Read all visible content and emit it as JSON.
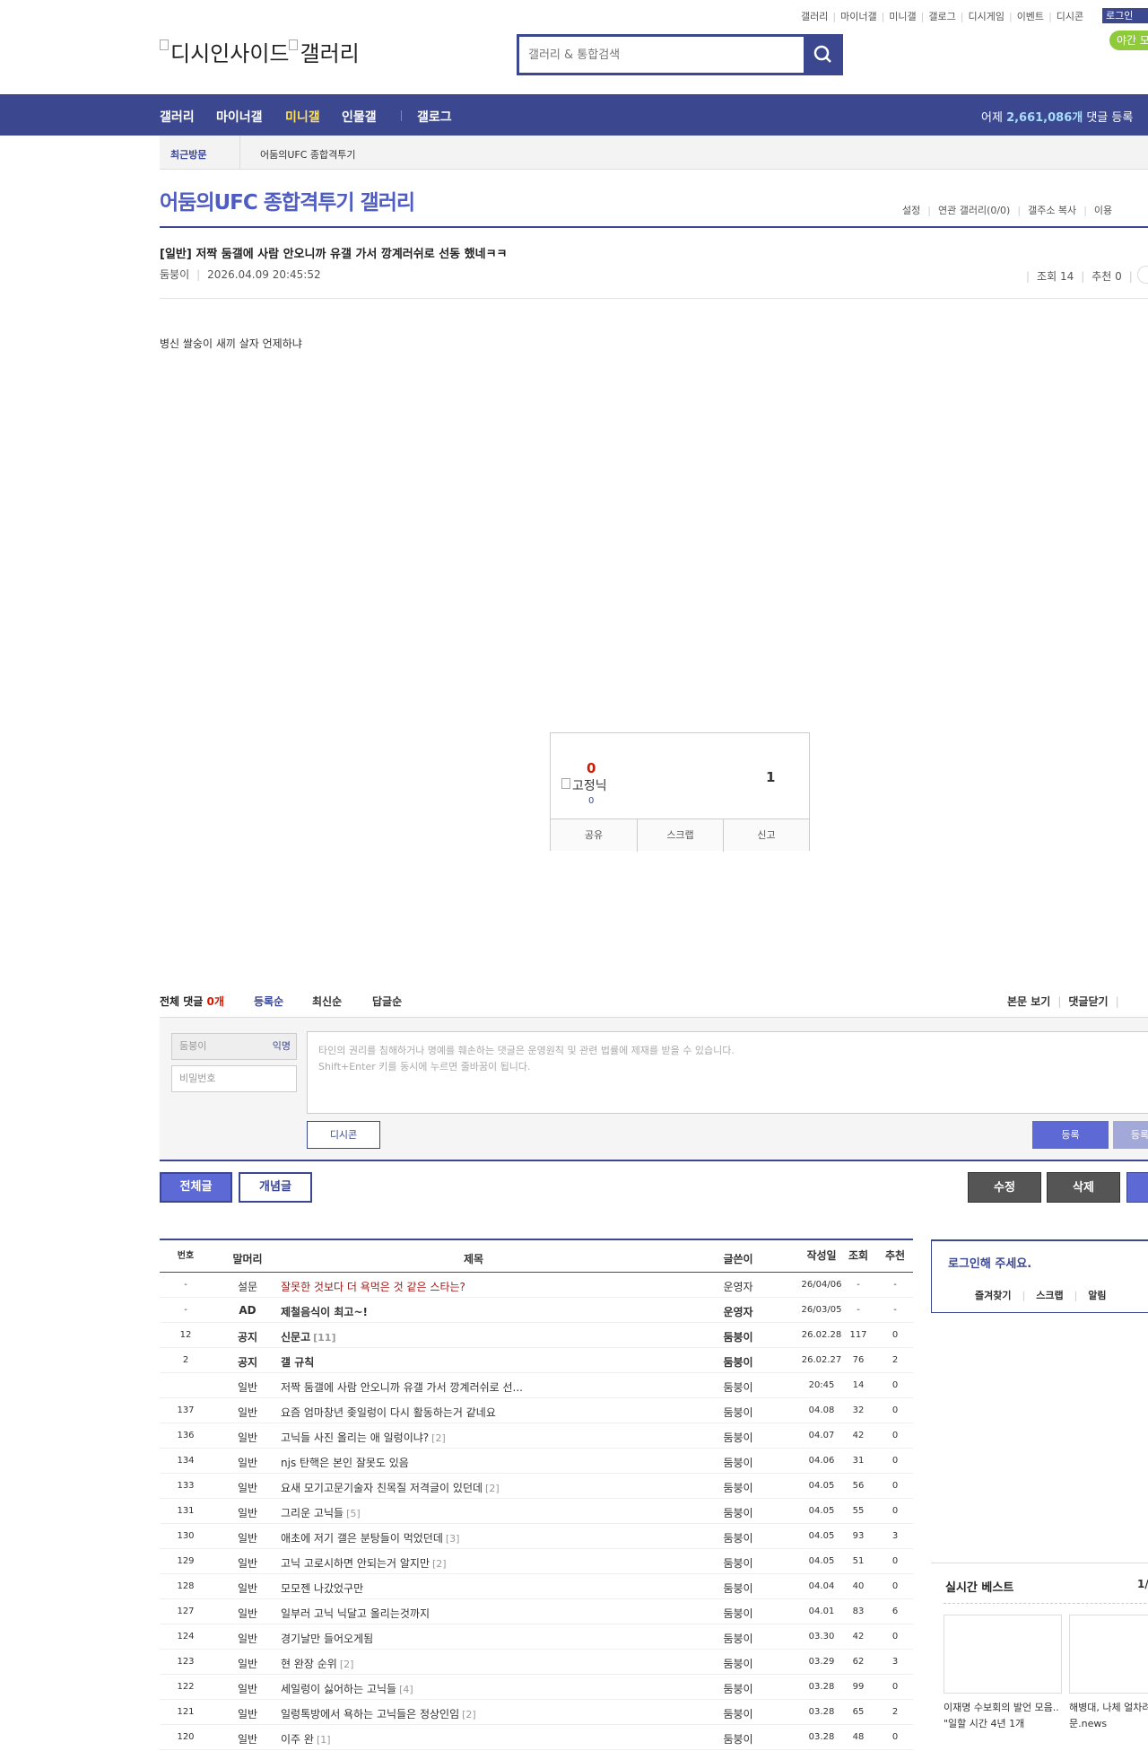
{
  "top_links": [
    "갤러리",
    "마이너갤",
    "미니갤",
    "갤로그",
    "디시게임",
    "이벤트",
    "디시콘"
  ],
  "login_label": "로그인",
  "night_label": "야간 모드",
  "logo_text": "디시인사이드",
  "logo_text2": "갤러리",
  "search": {
    "placeholder": "갤러리 & 통합검색"
  },
  "nav": {
    "items": [
      "갤러리",
      "마이너갤",
      "미니갤",
      "인물갤",
      "갤로그"
    ],
    "active": "미니갤",
    "right_prefix": "어제 ",
    "right_count": "2,661,086개",
    "right_suffix": " 댓글 등록"
  },
  "recent": {
    "label": "최근방문",
    "item": "어둠의UFC 종합격투기"
  },
  "gallery": {
    "title": "어둠의UFC 종합격투기 갤러리",
    "links": [
      "설정",
      "연관 갤러리(0/0)",
      "갤주소 복사",
      "이용"
    ]
  },
  "post": {
    "title": "[일반] 저짝 둠갤에 사람 안오니까 유갤 가서 깡계러쉬로 선동 했네ㅋㅋ",
    "author": "둠붕이",
    "date": "2026.04.09 20:45:52",
    "views": "조회 14",
    "recommend": "추천 0",
    "body": "병신 쌀숭이 새끼 살자 언제하냐"
  },
  "rec_box": {
    "up": "0",
    "fixed_label": "고정닉",
    "fixed_count": "0",
    "down": "1",
    "actions": [
      "공유",
      "스크랩",
      "신고"
    ]
  },
  "comments": {
    "head_label": "전체 댓글 ",
    "count": "0개",
    "sort": [
      "등록순",
      "최신순",
      "답글순"
    ],
    "right_links": [
      "본문 보기",
      "댓글닫기"
    ],
    "name_placeholder": "둠붕이",
    "anon_label": "익명",
    "pw_placeholder": "비밀번호",
    "text_line1": "타인의 권리를 침해하거나 명예를 훼손하는 댓글은 운영원칙 및 관련 법률에 제재를 받을 수 있습니다.",
    "text_line2": "Shift+Enter 키를 동시에 누르면 줄바꿈이 됩니다.",
    "dccon_label": "디시콘",
    "submit_label": "등록",
    "submit2_label": "등록"
  },
  "buttons": {
    "all": "전체글",
    "concept": "개념글",
    "edit": "수정",
    "delete": "삭제"
  },
  "list": {
    "headers": {
      "num": "번호",
      "head": "말머리",
      "title": "제목",
      "writer": "글쓴이",
      "date": "작성일",
      "view": "조회",
      "rec": "추천"
    },
    "rows": [
      {
        "num": "-",
        "head": "설문",
        "title": "잘못한 것보다 더 욕먹은 것 같은 스타는?",
        "reply": "",
        "writer": "운영자",
        "date": "26/04/06",
        "view": "-",
        "rec": "-",
        "type": "survey"
      },
      {
        "num": "-",
        "head": "AD",
        "title": "제철음식이 최고~!",
        "reply": "",
        "writer": "운영자",
        "date": "26/03/05",
        "view": "-",
        "rec": "-",
        "type": "notice"
      },
      {
        "num": "12",
        "head": "공지",
        "title": "신문고",
        "reply": "[11]",
        "writer": "둠붕이",
        "date": "26.02.28",
        "view": "117",
        "rec": "0",
        "type": "notice"
      },
      {
        "num": "2",
        "head": "공지",
        "title": "갤 규칙",
        "reply": "",
        "writer": "둠붕이",
        "date": "26.02.27",
        "view": "76",
        "rec": "2",
        "type": "notice"
      },
      {
        "num": "",
        "head": "일반",
        "title": "저짝 둠갤에 사람 안오니까 유갤 가서 깡계러쉬로 선...",
        "reply": "",
        "writer": "둠붕이",
        "date": "20:45",
        "view": "14",
        "rec": "0",
        "type": "normal"
      },
      {
        "num": "137",
        "head": "일반",
        "title": "요즘 엄마창년 좆일렁이 다시 활동하는거 같네요",
        "reply": "",
        "writer": "둠붕이",
        "date": "04.08",
        "view": "32",
        "rec": "0",
        "type": "normal"
      },
      {
        "num": "136",
        "head": "일반",
        "title": "고닉들 사진 올리는 애 일렁이냐?",
        "reply": "[2]",
        "writer": "둠붕이",
        "date": "04.07",
        "view": "42",
        "rec": "0",
        "type": "normal"
      },
      {
        "num": "134",
        "head": "일반",
        "title": "njs 탄핵은 본인 잘못도 있음",
        "reply": "",
        "writer": "둠붕이",
        "date": "04.06",
        "view": "31",
        "rec": "0",
        "type": "normal"
      },
      {
        "num": "133",
        "head": "일반",
        "title": "요새 모기고문기술자 친목질 저격글이 있던데",
        "reply": "[2]",
        "writer": "둠붕이",
        "date": "04.05",
        "view": "56",
        "rec": "0",
        "type": "normal"
      },
      {
        "num": "131",
        "head": "일반",
        "title": "그리운 고닉들",
        "reply": "[5]",
        "writer": "둠붕이",
        "date": "04.05",
        "view": "55",
        "rec": "0",
        "type": "normal"
      },
      {
        "num": "130",
        "head": "일반",
        "title": "애초에 저기 갤은 분탕들이 먹었던데",
        "reply": "[3]",
        "writer": "둠붕이",
        "date": "04.05",
        "view": "93",
        "rec": "3",
        "type": "normal"
      },
      {
        "num": "129",
        "head": "일반",
        "title": "고닉 고로시하면 안되는거 알지만",
        "reply": "[2]",
        "writer": "둠붕이",
        "date": "04.05",
        "view": "51",
        "rec": "0",
        "type": "normal"
      },
      {
        "num": "128",
        "head": "일반",
        "title": "모모젠 나갔었구만",
        "reply": "",
        "writer": "둠붕이",
        "date": "04.04",
        "view": "40",
        "rec": "0",
        "type": "normal"
      },
      {
        "num": "127",
        "head": "일반",
        "title": "일부러 고닉 닉달고 올리는것까지",
        "reply": "",
        "writer": "둠붕이",
        "date": "04.01",
        "view": "83",
        "rec": "6",
        "type": "normal"
      },
      {
        "num": "124",
        "head": "일반",
        "title": "경기날만 들어오게됨",
        "reply": "",
        "writer": "둠붕이",
        "date": "03.30",
        "view": "42",
        "rec": "0",
        "type": "normal"
      },
      {
        "num": "123",
        "head": "일반",
        "title": "현 완장 순위",
        "reply": "[2]",
        "writer": "둠붕이",
        "date": "03.29",
        "view": "62",
        "rec": "3",
        "type": "normal"
      },
      {
        "num": "122",
        "head": "일반",
        "title": "세일렁이 싫어하는 고닉들",
        "reply": "[4]",
        "writer": "둠붕이",
        "date": "03.28",
        "view": "99",
        "rec": "0",
        "type": "normal"
      },
      {
        "num": "121",
        "head": "일반",
        "title": "일렁톡방에서 욕하는 고닉들은 정상인임",
        "reply": "[2]",
        "writer": "둠붕이",
        "date": "03.28",
        "view": "65",
        "rec": "2",
        "type": "normal"
      },
      {
        "num": "120",
        "head": "일반",
        "title": "이주 완",
        "reply": "[1]",
        "writer": "둠붕이",
        "date": "03.28",
        "view": "48",
        "rec": "0",
        "type": "normal"
      }
    ]
  },
  "login_panel": {
    "title": "로그인해 주세요.",
    "links": [
      "즐겨찾기",
      "스크랩",
      "알림"
    ]
  },
  "best": {
    "title": "실시간 베스트",
    "page": "1/",
    "cap1": "이재명 수보회의 발언 모음.. \"일할 시간 4년 1개",
    "cap2": "해병대, 나체 얼차려 식고문.news"
  },
  "colors": {
    "brand": "#3b4890",
    "accent": "#5d6ad6",
    "nav_active": "#ffe05a",
    "alert_red": "#d31900"
  }
}
